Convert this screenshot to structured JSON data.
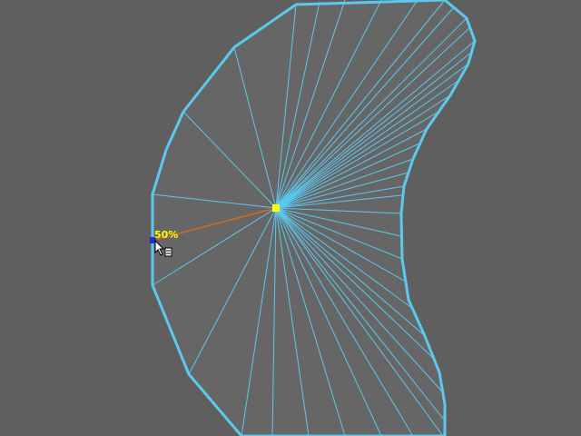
{
  "viewport": {
    "background_color": "#5f5f5f"
  },
  "mesh": {
    "outline_color": "#5cc8ee",
    "edge_color": "#5cc8ee",
    "fill_color": "#666666"
  },
  "center_vertex": {
    "color": "#ffff00"
  },
  "selected_vertex": {
    "color": "#1f2fd0"
  },
  "split_edge": {
    "color": "#d46a17"
  },
  "edge_percent": {
    "text": "50%",
    "color": "#ffff00"
  },
  "cursor": {
    "icon": "edge-split-cursor-icon"
  }
}
